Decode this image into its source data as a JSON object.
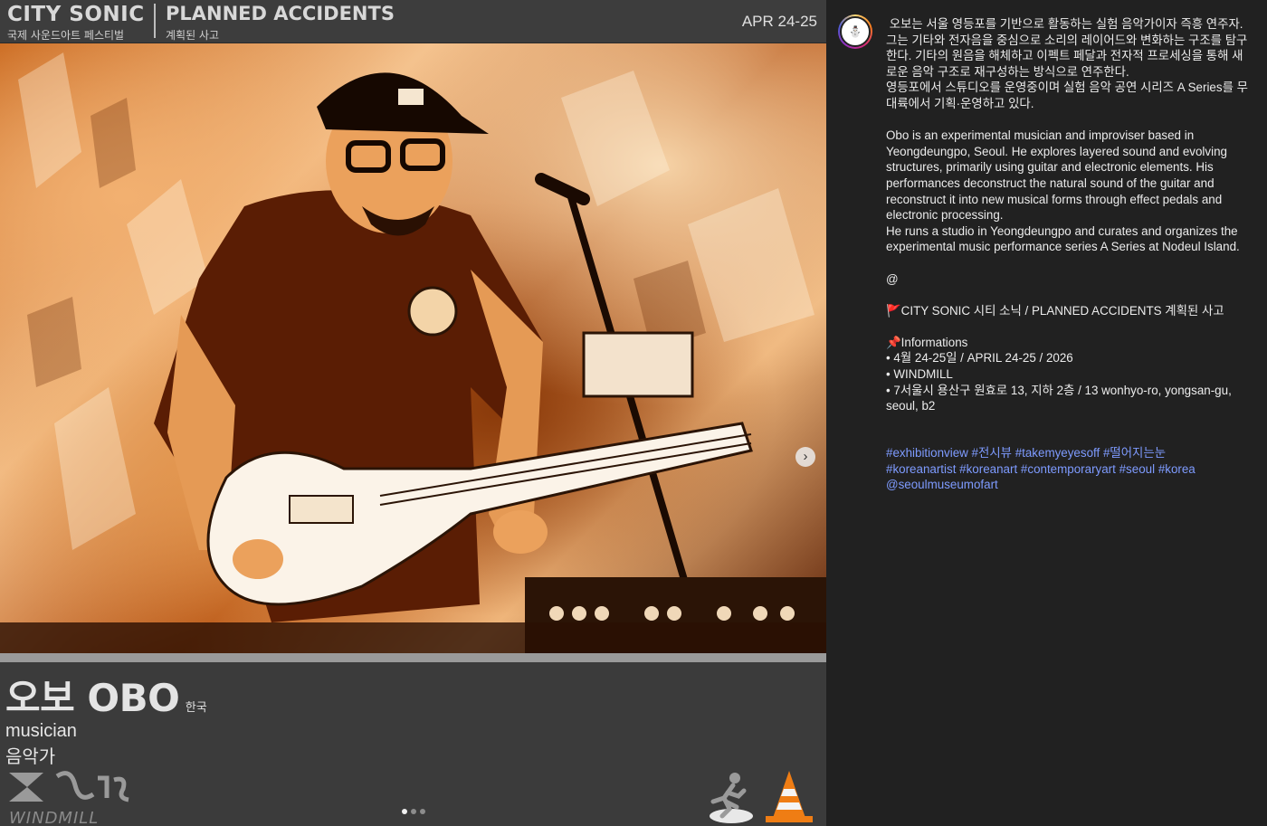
{
  "header": {
    "brand": "CITY SONIC",
    "brand_sub": "국제 사운드아트 페스티벌",
    "title": "PLANNED ACCIDENTS",
    "title_sub": "계획된 사고",
    "date": "APR 24-25"
  },
  "artist": {
    "name": "오보 OBO",
    "country": "한국",
    "role_en": "musician",
    "role_ko": "음악가"
  },
  "logos": {
    "windmill": "WINDMILL"
  },
  "carousel": {
    "next_glyph": "›",
    "count": 3,
    "active_index": 0
  },
  "post": {
    "avatar_glyph": "⛄",
    "text": " 오보는 서울 영등포를 기반으로 활동하는 실험 음악가이자 즉흥 연주자.\n그는 기타와 전자음을 중심으로 소리의 레이어드와 변화하는 구조를 탐구한다. 기타의 원음을 해체하고 이펙트 페달과 전자적 프로세싱을 통해 새로운 음악 구조로 재구성하는 방식으로 연주한다.\n영등포에서 스튜디오를 운영중이며 실험 음악 공연 시리즈 A Series를 무대륙에서 기획·운영하고 있다.\n\nObo is an experimental musician and improviser based in Yeongdeungpo, Seoul. He explores layered sound and evolving structures, primarily using guitar and electronic elements. His performances deconstruct the natural sound of the guitar and reconstruct it into new musical forms through effect pedals and electronic processing.\nHe runs a studio in Yeongdeungpo and curates and organizes the experimental music performance series A Series at Nodeul Island.\n\n@\n\n🚩CITY SONIC 시티 소닉 / PLANNED ACCIDENTS 계획된 사고\n\n📌Informations\n• 4월 24-25일 / APRIL 24-25 / 2026\n• WINDMILL\n• 7서울시 용산구 원효로 13, 지하 2층 / 13 wonhyo-ro, yongsan-gu, seoul, b2",
    "hashtags": [
      "#exhibitionview",
      "#전시뷰",
      "#takemyeyesoff",
      "#떨어지는눈",
      "#koreanartist",
      "#koreanart",
      "#contemporaryart",
      "#seoul",
      "#korea",
      "@seoulmuseumofart"
    ]
  }
}
